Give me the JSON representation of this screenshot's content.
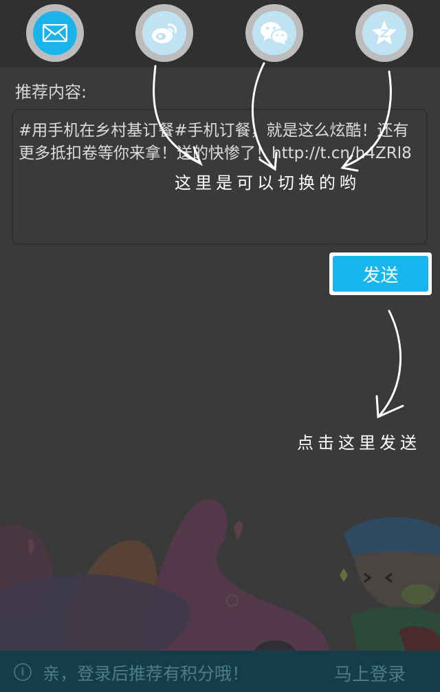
{
  "share_bar": {
    "items": [
      {
        "name": "email",
        "icon": "mail-icon",
        "selected": true
      },
      {
        "name": "weibo",
        "icon": "weibo-icon",
        "selected": false
      },
      {
        "name": "wechat",
        "icon": "wechat-icon",
        "selected": false
      },
      {
        "name": "qzone",
        "icon": "qzone-star-icon",
        "selected": false
      }
    ]
  },
  "form": {
    "label": "推荐内容:",
    "content": "#用手机在乡村基订餐#手机订餐，就是这么炫酷！还有更多抵扣卷等你来拿！送的快惨了！http://t.cn/h4ZRl8",
    "send_label": "发送"
  },
  "overlay": {
    "switch_hint": "这里是可以切换的哟",
    "send_hint": "点击这里发送"
  },
  "footer": {
    "message": "亲，登录后推荐有积分哦！",
    "login_label": "马上登录"
  },
  "colors": {
    "accent": "#18b6ef",
    "footer_bg": "#153c48"
  }
}
